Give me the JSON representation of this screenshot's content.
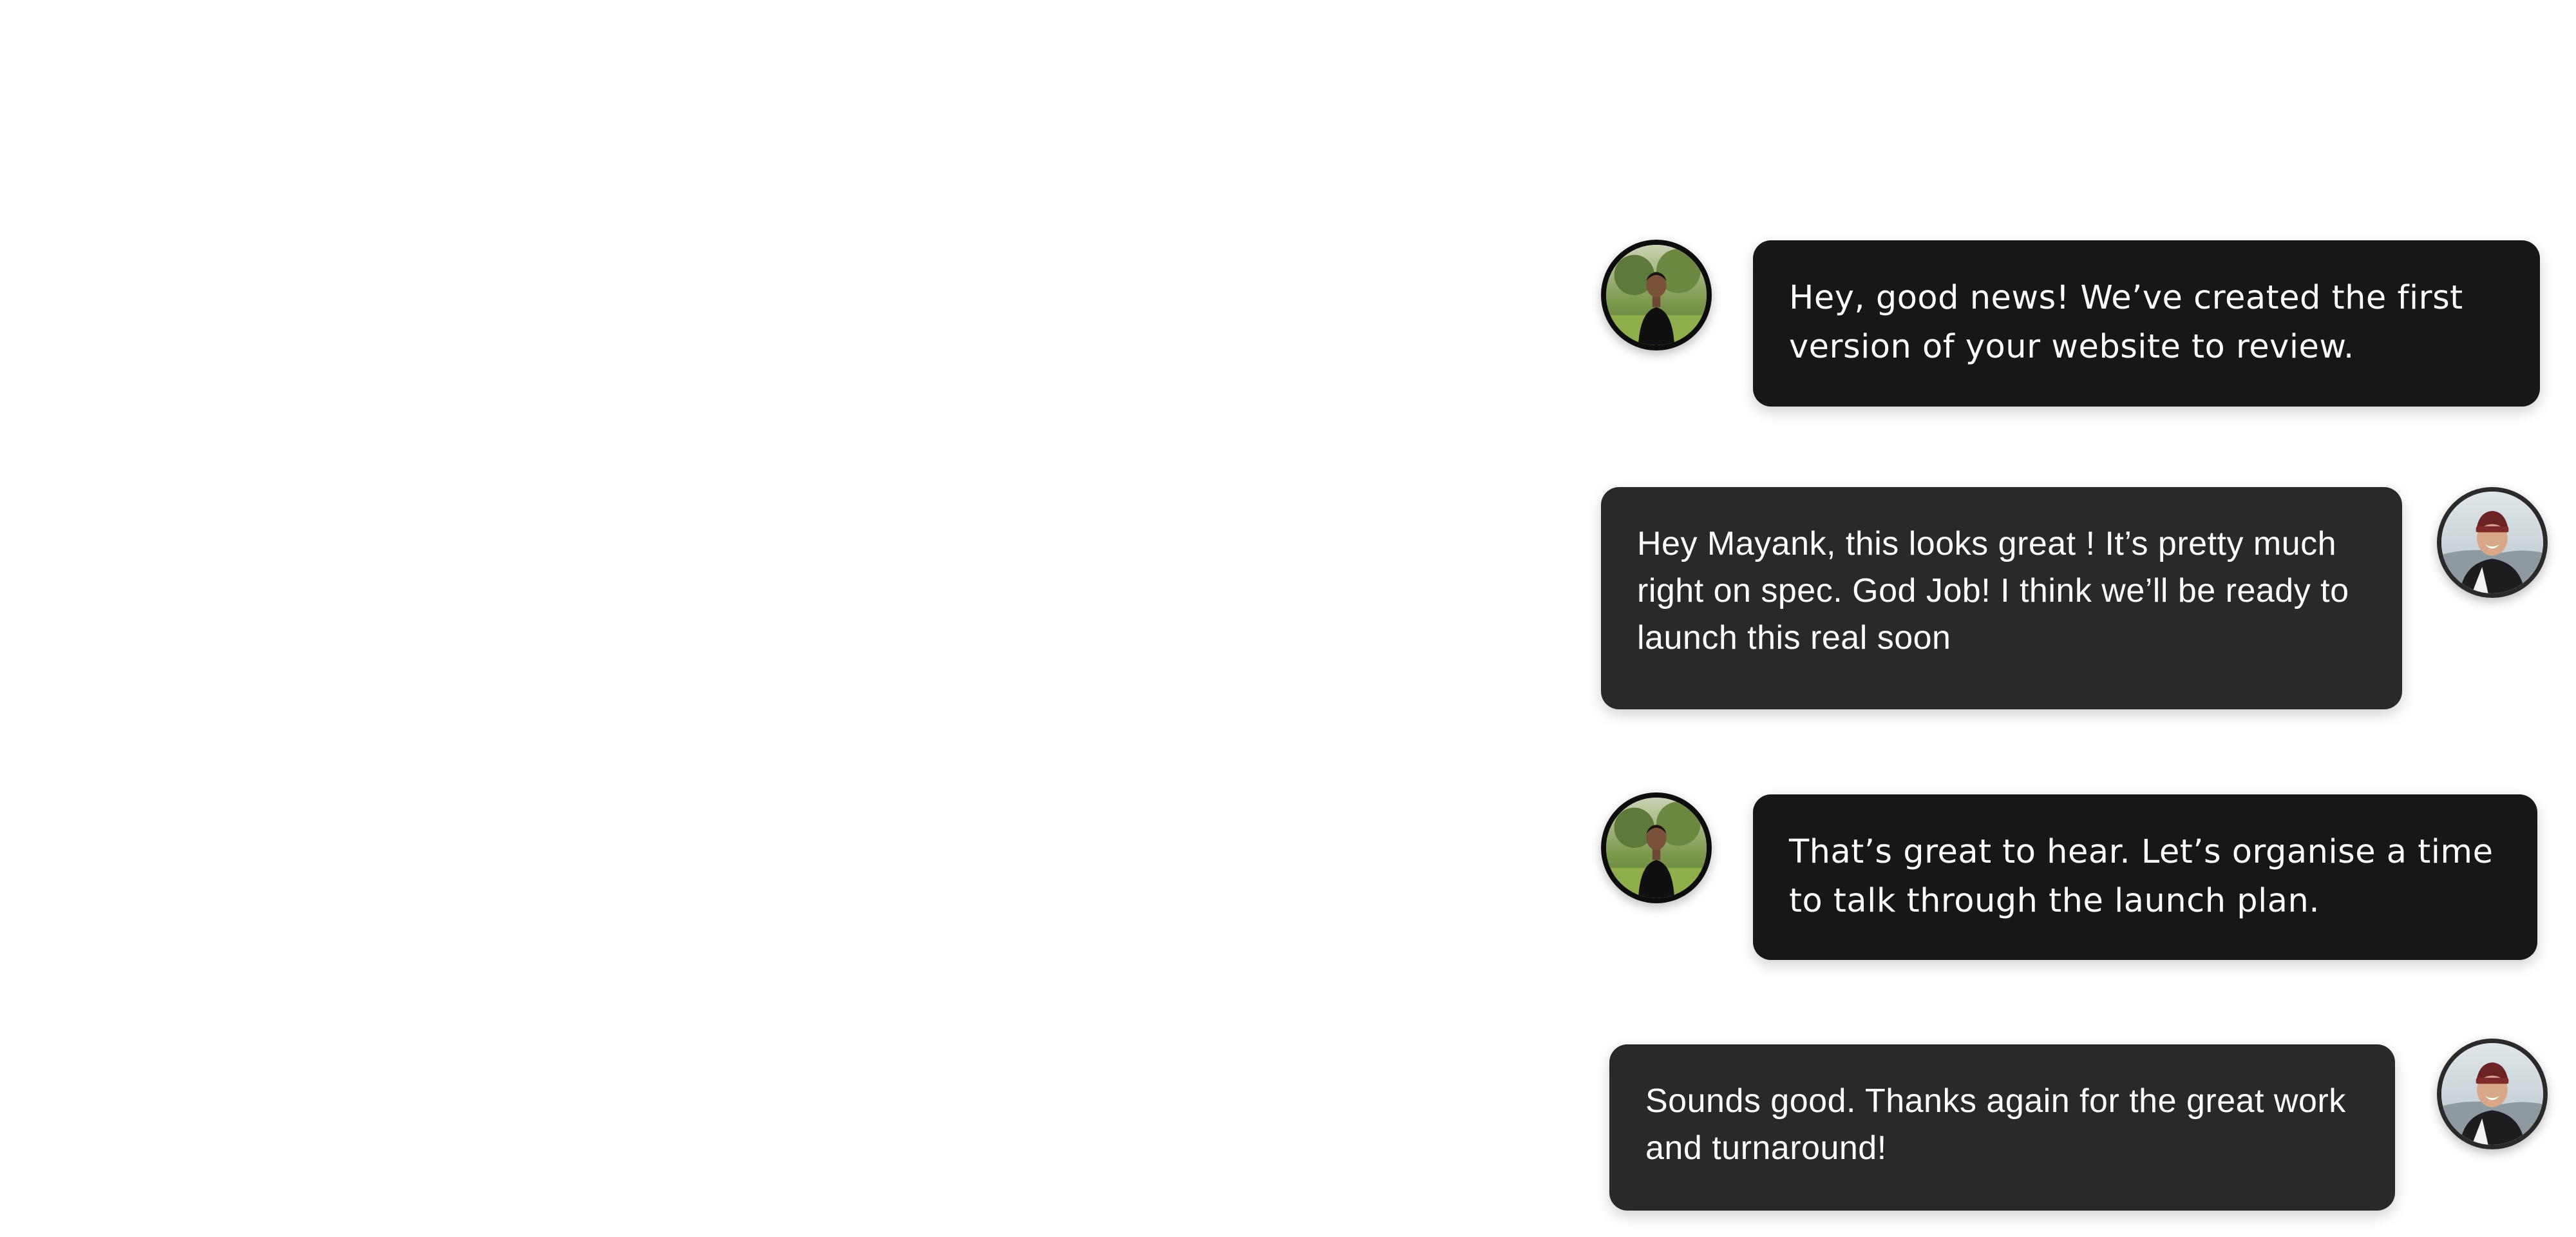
{
  "conversation": {
    "messages": [
      {
        "sender": "team",
        "avatar_icon": "team-member-avatar-icon",
        "text": "Hey, good news! We’ve created the first version of your website to review."
      },
      {
        "sender": "client",
        "avatar_icon": "client-avatar-icon",
        "text": "Hey Mayank, this looks great ! It’s pretty much right on spec. God Job! I think we’ll be ready to launch this real soon"
      },
      {
        "sender": "team",
        "avatar_icon": "team-member-avatar-icon",
        "text": "That’s great to hear. Let’s organise a time to talk through the launch plan."
      },
      {
        "sender": "client",
        "avatar_icon": "client-avatar-icon",
        "text": "Sounds good. Thanks again for the great work and turnaround!"
      }
    ]
  },
  "colors": {
    "page_background": "#ffffff",
    "team_bubble": "#171717",
    "client_bubble": "#292929",
    "bubble_text": "#ffffff"
  }
}
